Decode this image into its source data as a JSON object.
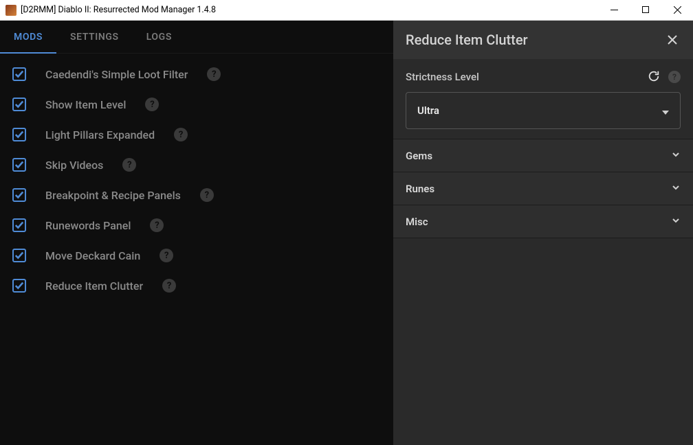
{
  "titlebar": {
    "title": "[D2RMM] Diablo II: Resurrected Mod Manager 1.4.8"
  },
  "tabs": [
    {
      "label": "MODS",
      "active": true
    },
    {
      "label": "SETTINGS",
      "active": false
    },
    {
      "label": "LOGS",
      "active": false
    }
  ],
  "mods": [
    {
      "name": "Caedendi's Simple Loot Filter",
      "enabled": true,
      "help": true
    },
    {
      "name": "Show Item Level",
      "enabled": true,
      "help": true
    },
    {
      "name": "Light Pillars Expanded",
      "enabled": true,
      "help": true
    },
    {
      "name": "Skip Videos",
      "enabled": true,
      "help": true
    },
    {
      "name": "Breakpoint & Recipe Panels",
      "enabled": true,
      "help": true
    },
    {
      "name": "Runewords Panel",
      "enabled": true,
      "help": true
    },
    {
      "name": "Move Deckard Cain",
      "enabled": true,
      "help": true
    },
    {
      "name": "Reduce Item Clutter",
      "enabled": true,
      "help": true
    }
  ],
  "panel": {
    "title": "Reduce Item Clutter",
    "field_label": "Strictness Level",
    "select_value": "Ultra",
    "sections": [
      {
        "label": "Gems"
      },
      {
        "label": "Runes"
      },
      {
        "label": "Misc"
      }
    ]
  }
}
